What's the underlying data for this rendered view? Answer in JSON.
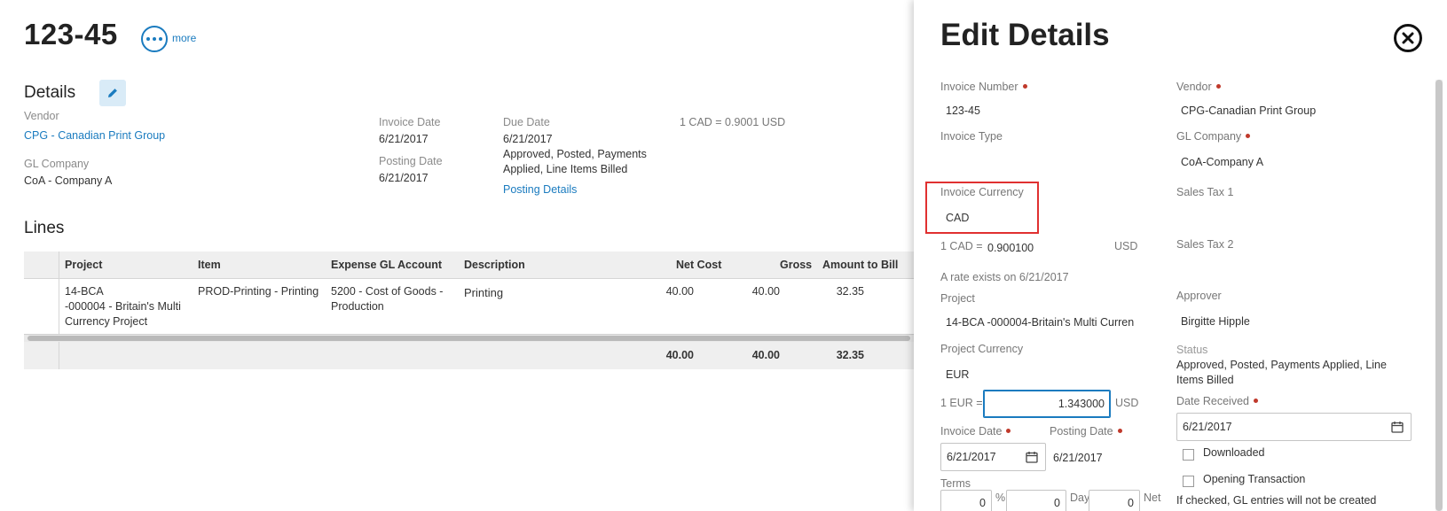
{
  "header": {
    "invoice_number": "123-45",
    "more_label": "more"
  },
  "details": {
    "heading": "Details",
    "vendor_label": "Vendor",
    "vendor_value": "CPG - Canadian Print Group",
    "gl_company_label": "GL Company",
    "gl_company_value": "CoA - Company A",
    "invoice_date_label": "Invoice Date",
    "invoice_date_value": "6/21/2017",
    "posting_date_label": "Posting Date",
    "posting_date_value": "6/21/2017",
    "due_date_label": "Due Date",
    "due_date_value": "6/21/2017",
    "status_line1": "Approved, Posted, Payments",
    "status_line2": "Applied, Line Items Billed",
    "posting_details_link": "Posting Details",
    "exchange_rate": "1 CAD =  0.9001  USD"
  },
  "lines": {
    "heading": "Lines",
    "columns": [
      "Project",
      "Item",
      "Expense GL Account",
      "Description",
      "Net Cost",
      "Gross",
      "Amount to Bill"
    ],
    "rows": [
      {
        "project": [
          "14-BCA",
          "-000004 - Britain's Multi",
          "Currency Project"
        ],
        "item": "PROD-Printing - Printing",
        "gl_account": [
          "5200 - Cost of Goods -",
          "Production"
        ],
        "description": "Printing",
        "net_cost": "40.00",
        "gross": "40.00",
        "amount_to_bill": "32.35"
      }
    ],
    "totals": {
      "net_cost": "40.00",
      "gross": "40.00",
      "amount_to_bill": "32.35"
    }
  },
  "edit_panel": {
    "title": "Edit Details",
    "invoice_number_label": "Invoice Number",
    "invoice_number_value": "123-45",
    "invoice_type_label": "Invoice Type",
    "invoice_type_value": "",
    "invoice_currency_label": "Invoice Currency",
    "invoice_currency_value": "CAD",
    "cad_rate_prefix": "1 CAD =",
    "cad_rate_value": "0.900100",
    "cad_rate_unit": "USD",
    "rate_note": "A rate exists on 6/21/2017",
    "project_label": "Project",
    "project_value": "14-BCA -000004-Britain's Multi Curren",
    "project_currency_label": "Project Currency",
    "project_currency_value": "EUR",
    "eur_rate_prefix": "1 EUR =",
    "eur_rate_value": "1.343000",
    "eur_rate_unit": "USD",
    "invoice_date_label": "Invoice Date",
    "invoice_date_value": "6/21/2017",
    "posting_date_label": "Posting Date",
    "posting_date_value": "6/21/2017",
    "terms_label": "Terms",
    "terms_percent_value": "0",
    "terms_percent_unit": "%",
    "terms_days_value": "0",
    "terms_days_unit": "Days",
    "terms_net_value": "0",
    "terms_net_unit": "Net",
    "vendor_label": "Vendor",
    "vendor_value": "CPG-Canadian Print Group",
    "gl_company_label": "GL Company",
    "gl_company_value": "CoA-Company A",
    "sales_tax1_label": "Sales Tax 1",
    "sales_tax2_label": "Sales Tax 2",
    "approver_label": "Approver",
    "approver_value": "Birgitte Hipple",
    "status_label": "Status",
    "status_line1": "Approved, Posted, Payments Applied, Line",
    "status_line2": "Items Billed",
    "date_received_label": "Date Received",
    "date_received_value": "6/21/2017",
    "downloaded_label": "Downloaded",
    "downloaded_checked": false,
    "opening_transaction_label": "Opening Transaction",
    "opening_transaction_checked": false,
    "gl_note": "If checked, GL entries will not be created"
  },
  "colors": {
    "accent": "#1a7bbf",
    "required": "#c0392b",
    "highlight": "#e03030"
  }
}
